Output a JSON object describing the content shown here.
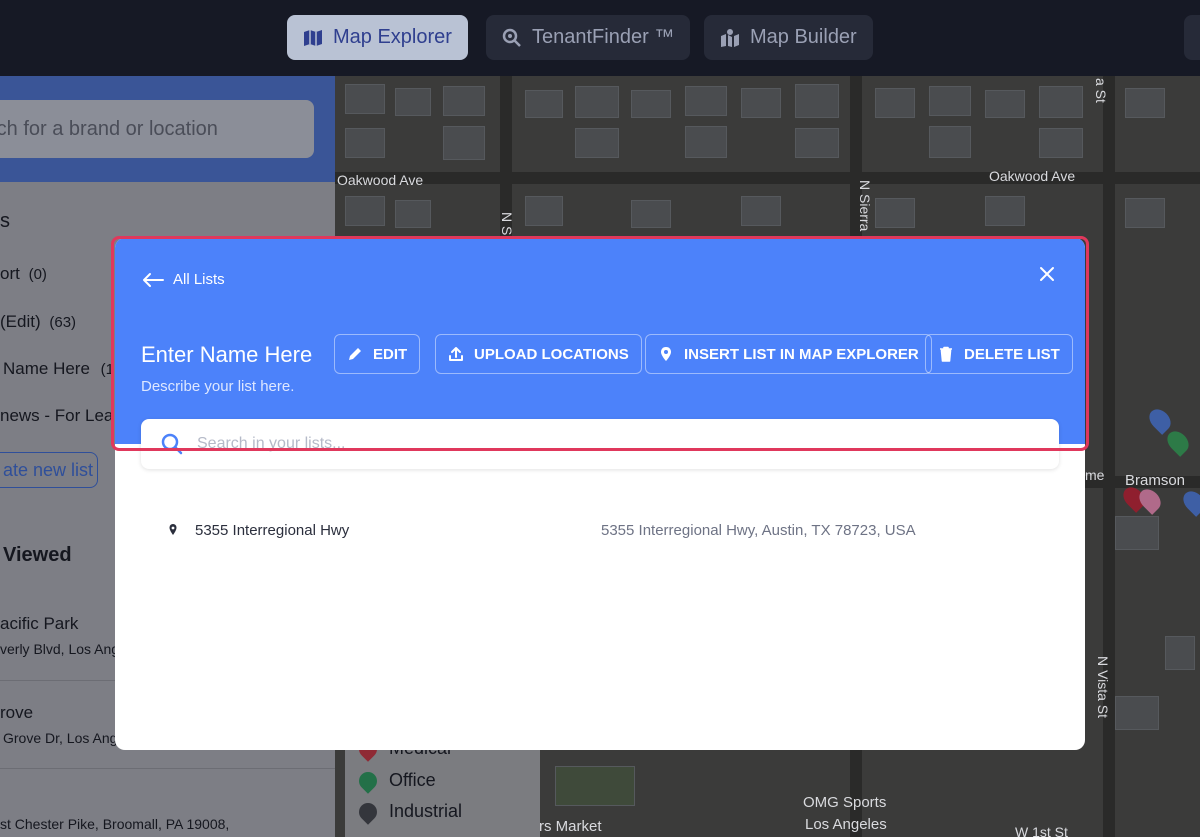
{
  "nav": {
    "tabs": [
      {
        "label": "Map Explorer",
        "icon": "map-icon"
      },
      {
        "label": "TenantFinder ™",
        "icon": "magnify-icon"
      },
      {
        "label": "Map Builder",
        "icon": "map-pin-icon"
      }
    ]
  },
  "sidebar": {
    "search_placeholder": "rch for a brand or location",
    "section_lists": "s",
    "lists": [
      {
        "label": "ort",
        "count": "(0)"
      },
      {
        "label": "(Edit)",
        "count": "(63)"
      },
      {
        "label": "Name Here",
        "count": "(1"
      },
      {
        "label": "news - For Lea",
        "count": ""
      }
    ],
    "create_button": "ate new list",
    "recent_heading": "Viewed",
    "recent": [
      {
        "name": "acific Park",
        "address": "verly Blvd, Los Ang"
      },
      {
        "name": "rove",
        "address": "Grove Dr, Los Ange"
      },
      {
        "name": "",
        "address": "st Chester Pike, Broomall, PA 19008,"
      }
    ]
  },
  "map": {
    "streets": [
      "Oakwood Ave",
      "Oakwood Ave",
      "N Sierra",
      "Bramson",
      "N Vista St",
      "W 1st St",
      "me",
      "a St",
      "N S"
    ],
    "places": [
      "OMG Sports",
      "Los Angeles",
      "rs Market"
    ],
    "legend": [
      "Medical",
      "Office",
      "Industrial"
    ]
  },
  "modal": {
    "back_label": "All Lists",
    "title": "Enter Name Here",
    "description": "Describe your list here.",
    "buttons": {
      "edit": "EDIT",
      "upload": "UPLOAD LOCATIONS",
      "insert": "INSERT LIST IN MAP EXPLORER",
      "delete": "DELETE LIST"
    },
    "search_placeholder": "Search in your lists...",
    "items": [
      {
        "name": "5355 Interregional Hwy",
        "address": "5355 Interregional Hwy, Austin, TX 78723, USA"
      }
    ]
  },
  "colors": {
    "header_blue": "#4c82fa",
    "highlight_red": "#e0385c",
    "legend_medical": "#c73a4a",
    "legend_office": "#2f9a5a",
    "legend_industrial": "#3b3d44"
  }
}
